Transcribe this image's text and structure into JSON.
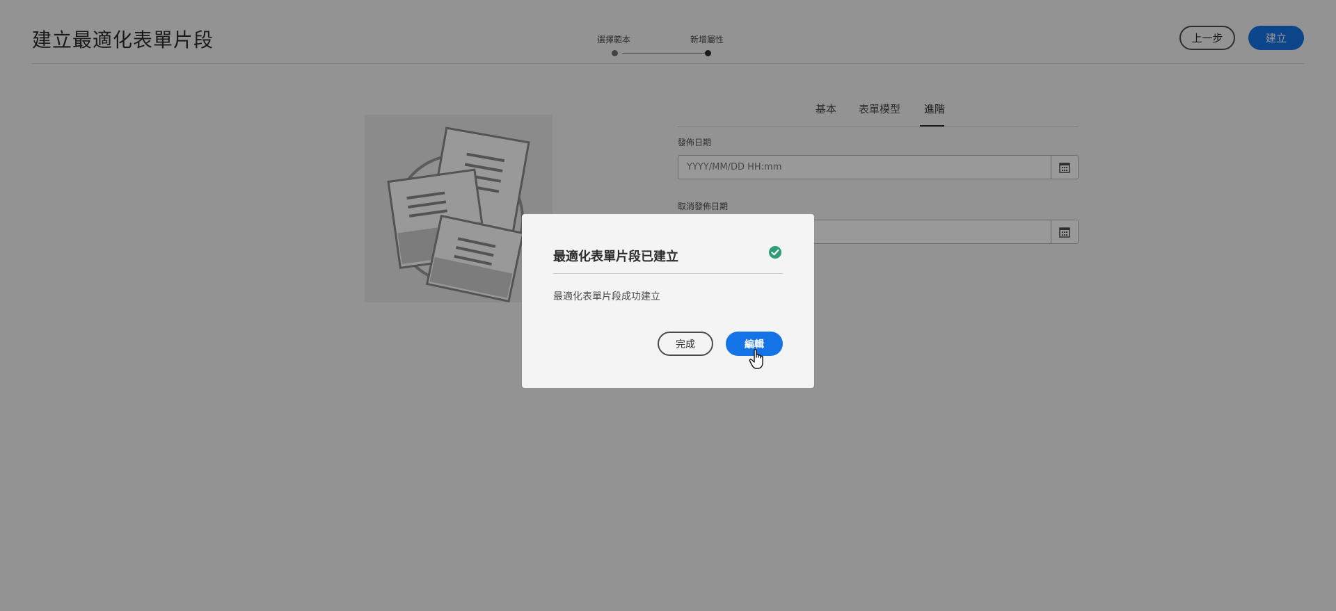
{
  "header": {
    "title": "建立最適化表單片段",
    "back_label": "上一步",
    "create_label": "建立"
  },
  "stepper": {
    "steps": [
      {
        "label": "選擇範本"
      },
      {
        "label": "新增屬性"
      }
    ]
  },
  "tabs": [
    {
      "label": "基本"
    },
    {
      "label": "表單模型"
    },
    {
      "label": "進階"
    }
  ],
  "fields": {
    "publish_date": {
      "label": "發佈日期",
      "placeholder": "YYYY/MM/DD HH:mm"
    },
    "unpublish_date": {
      "label": "取消發佈日期"
    }
  },
  "dialog": {
    "title": "最適化表單片段已建立",
    "body": "最適化表單片段成功建立",
    "done_label": "完成",
    "edit_label": "編輯"
  },
  "colors": {
    "accent": "#1473e6",
    "success": "#2d9d78",
    "overlay": "rgba(0,0,0,0.4)"
  },
  "icons": [
    "calendar-icon",
    "success-check-icon",
    "hand-pointer-icon",
    "forms-illustration"
  ]
}
